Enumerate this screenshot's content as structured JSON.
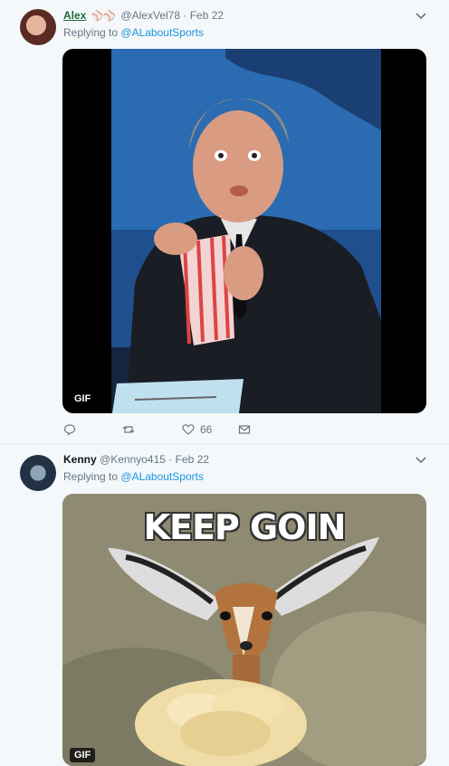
{
  "tweets": [
    {
      "name": "Alex",
      "emoji": "⚾⚾",
      "handle": "@AlexVel78",
      "date": "Feb 22",
      "reply_prefix": "Replying to",
      "reply_to": "@ALaboutSports",
      "media_badge": "GIF",
      "actions": {
        "reply": "",
        "retweet": "",
        "likes": "66",
        "dm": ""
      }
    },
    {
      "name": "Kenny",
      "handle": "@Kennyo415",
      "date": "Feb 22",
      "reply_prefix": "Replying to",
      "reply_to": "@ALaboutSports",
      "media_caption": "KEEP GOIN",
      "media_badge": "GIF"
    }
  ],
  "separator": "·",
  "icons": [
    "chevron-down-icon",
    "reply-icon",
    "retweet-icon",
    "like-icon",
    "mail-icon"
  ]
}
